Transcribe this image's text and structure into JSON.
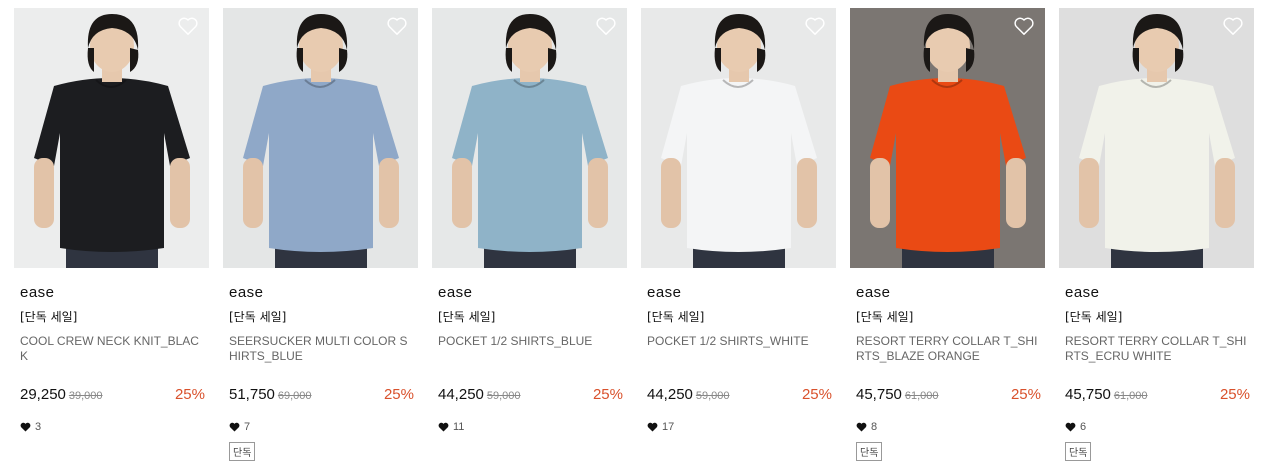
{
  "products": [
    {
      "brand": "ease",
      "tag": "[단독 세일]",
      "name": "COOL CREW NECK KNIT_BLACK",
      "price": "29,250",
      "original_price": "39,000",
      "discount": "25%",
      "likes": "3",
      "badge": "",
      "bg_color": "#eceded",
      "garment_color": "#1c1d20"
    },
    {
      "brand": "ease",
      "tag": "[단독 세일]",
      "name": "SEERSUCKER MULTI COLOR SHIRTS_BLUE",
      "price": "51,750",
      "original_price": "69,000",
      "discount": "25%",
      "likes": "7",
      "badge": "단독",
      "bg_color": "#e4e6e6",
      "garment_color": "#8fa8c8"
    },
    {
      "brand": "ease",
      "tag": "[단독 세일]",
      "name": "POCKET 1/2 SHIRTS_BLUE",
      "price": "44,250",
      "original_price": "59,000",
      "discount": "25%",
      "likes": "11",
      "badge": "",
      "bg_color": "#e6e8e8",
      "garment_color": "#8fb3c8"
    },
    {
      "brand": "ease",
      "tag": "[단독 세일]",
      "name": "POCKET 1/2 SHIRTS_WHITE",
      "price": "44,250",
      "original_price": "59,000",
      "discount": "25%",
      "likes": "17",
      "badge": "",
      "bg_color": "#e8e9e9",
      "garment_color": "#f4f5f6"
    },
    {
      "brand": "ease",
      "tag": "[단독 세일]",
      "name": "RESORT TERRY COLLAR T_SHIRTS_BLAZE ORANGE",
      "price": "45,750",
      "original_price": "61,000",
      "discount": "25%",
      "likes": "8",
      "badge": "단독",
      "bg_color": "#7b7672",
      "garment_color": "#ea4a14"
    },
    {
      "brand": "ease",
      "tag": "[단독 세일]",
      "name": "RESORT TERRY COLLAR T_SHIRTS_ECRU WHITE",
      "price": "45,750",
      "original_price": "61,000",
      "discount": "25%",
      "likes": "6",
      "badge": "단독",
      "bg_color": "#dedede",
      "garment_color": "#f1f2ea"
    }
  ],
  "icons": {
    "wishlist": "heart-outline-icon",
    "likes": "heart-filled-icon"
  }
}
